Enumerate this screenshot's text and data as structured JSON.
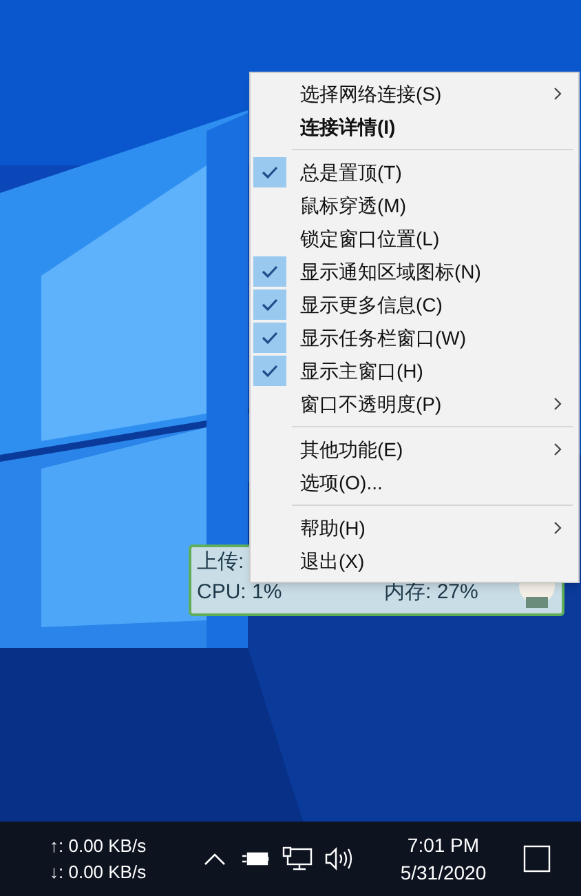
{
  "menu": {
    "items": [
      {
        "kind": "item",
        "label": "选择网络连接(S)",
        "bold": false,
        "checked": false,
        "submenu": true
      },
      {
        "kind": "item",
        "label": "连接详情(I)",
        "bold": true,
        "checked": false,
        "submenu": false
      },
      {
        "kind": "separator"
      },
      {
        "kind": "item",
        "label": "总是置顶(T)",
        "bold": false,
        "checked": true,
        "submenu": false
      },
      {
        "kind": "item",
        "label": "鼠标穿透(M)",
        "bold": false,
        "checked": false,
        "submenu": false
      },
      {
        "kind": "item",
        "label": "锁定窗口位置(L)",
        "bold": false,
        "checked": false,
        "submenu": false
      },
      {
        "kind": "item",
        "label": "显示通知区域图标(N)",
        "bold": false,
        "checked": true,
        "submenu": false
      },
      {
        "kind": "item",
        "label": "显示更多信息(C)",
        "bold": false,
        "checked": true,
        "submenu": false
      },
      {
        "kind": "item",
        "label": "显示任务栏窗口(W)",
        "bold": false,
        "checked": true,
        "submenu": false
      },
      {
        "kind": "item",
        "label": "显示主窗口(H)",
        "bold": false,
        "checked": true,
        "submenu": false
      },
      {
        "kind": "item",
        "label": "窗口不透明度(P)",
        "bold": false,
        "checked": false,
        "submenu": true
      },
      {
        "kind": "separator"
      },
      {
        "kind": "item",
        "label": "其他功能(E)",
        "bold": false,
        "checked": false,
        "submenu": true
      },
      {
        "kind": "item",
        "label": "选项(O)...",
        "bold": false,
        "checked": false,
        "submenu": false
      },
      {
        "kind": "separator"
      },
      {
        "kind": "item",
        "label": "帮助(H)",
        "bold": false,
        "checked": false,
        "submenu": true
      },
      {
        "kind": "item",
        "label": "退出(X)",
        "bold": false,
        "checked": false,
        "submenu": false
      }
    ]
  },
  "monitor_widget": {
    "upload_label": "上传:",
    "cpu": "CPU: 1%",
    "memory": "内存: 27%"
  },
  "taskbar": {
    "net_up": "↑: 0.00 KB/s",
    "net_down": "↓: 0.00 KB/s",
    "time": "7:01 PM",
    "date": "5/31/2020"
  }
}
